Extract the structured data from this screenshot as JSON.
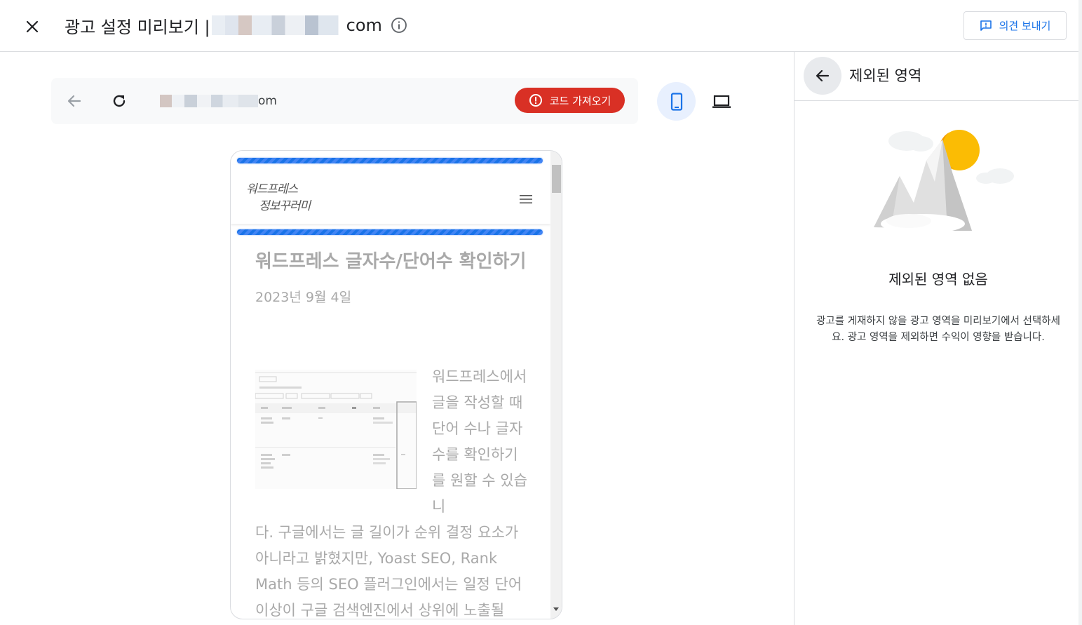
{
  "header": {
    "close_label": "close",
    "title_prefix": "광고 설정 미리보기 |",
    "title_suffix": "com",
    "feedback_label": "의견 보내기"
  },
  "urlbar": {
    "url_suffix": "om",
    "code_button_label": "코드 가져오기"
  },
  "site": {
    "logo_line1": "워드프레스",
    "logo_line2": "정보꾸러미",
    "post_title": "워드프레스 글자수/단어수 확인하기",
    "post_date": "2023년 9월 4일",
    "post_body_side": "워드프레스에서 글을 작성할 때 단어 수나 글자 수를 확인하기를 원할 수 있습니",
    "post_body_full": "다. 구글에서는 글 길이가 순위 결정 요소가 아니라고 밝혔지만, Yoast SEO, Rank Math 등의 SEO 플러그인에서는 일정 단어 이상이 구글 검색엔진에서 상위에 노출될"
  },
  "side": {
    "title": "제외된 영역",
    "empty_title": "제외된 영역 없음",
    "empty_desc": "광고를 게재하지 않을 광고 영역을 미리보기에서 선택하세요. 광고 영역을 제외하면 수익이 영향을 받습니다."
  },
  "colors": {
    "accent": "#1a73e8",
    "danger": "#d93025",
    "selected_bg": "#e8f0fe"
  },
  "icons": {
    "close": "close-icon",
    "info": "info-icon",
    "feedback": "feedback-icon",
    "back": "arrow-back-icon",
    "reload": "reload-icon",
    "error": "error-icon",
    "mobile": "smartphone-icon",
    "desktop": "laptop-icon",
    "menu": "hamburger-menu-icon"
  }
}
